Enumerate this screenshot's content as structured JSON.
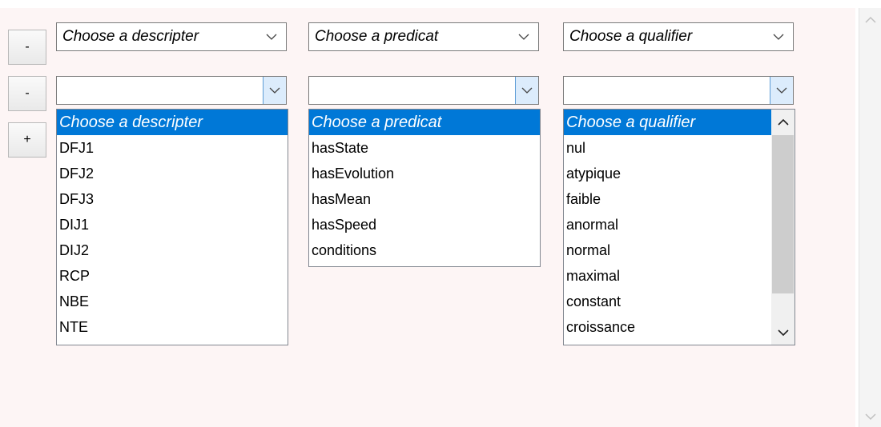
{
  "rows": [
    {
      "remove_label": "-",
      "descripter": {
        "value": "Choose a descripter"
      },
      "predicat": {
        "value": "Choose a predicat"
      },
      "qualifier": {
        "value": "Choose a qualifier"
      }
    },
    {
      "remove_label": "-",
      "descripter": {
        "value": ""
      },
      "predicat": {
        "value": ""
      },
      "qualifier": {
        "value": ""
      }
    }
  ],
  "add_label": "+",
  "dropdowns": {
    "descripter": {
      "highlighted": "Choose a descripter",
      "options": [
        "DFJ1",
        "DFJ2",
        "DFJ3",
        "DIJ1",
        "DIJ2",
        "RCP",
        "NBE",
        "NTE"
      ]
    },
    "predicat": {
      "highlighted": "Choose a predicat",
      "options": [
        "hasState",
        "hasEvolution",
        "hasMean",
        "hasSpeed",
        "conditions"
      ]
    },
    "qualifier": {
      "highlighted": "Choose a qualifier",
      "options": [
        "nul",
        "atypique",
        "faible",
        "anormal",
        "normal",
        "maximal",
        "constant",
        "croissance"
      ]
    }
  },
  "icons": {
    "combo_arrow": "chevron-down-icon",
    "scroll_up": "chevron-up-icon",
    "scroll_down": "chevron-down-icon"
  },
  "colors": {
    "selection": "#0078d7",
    "panel_bg": "#fdf5f5",
    "open_button_bg": "#dcecfc"
  }
}
